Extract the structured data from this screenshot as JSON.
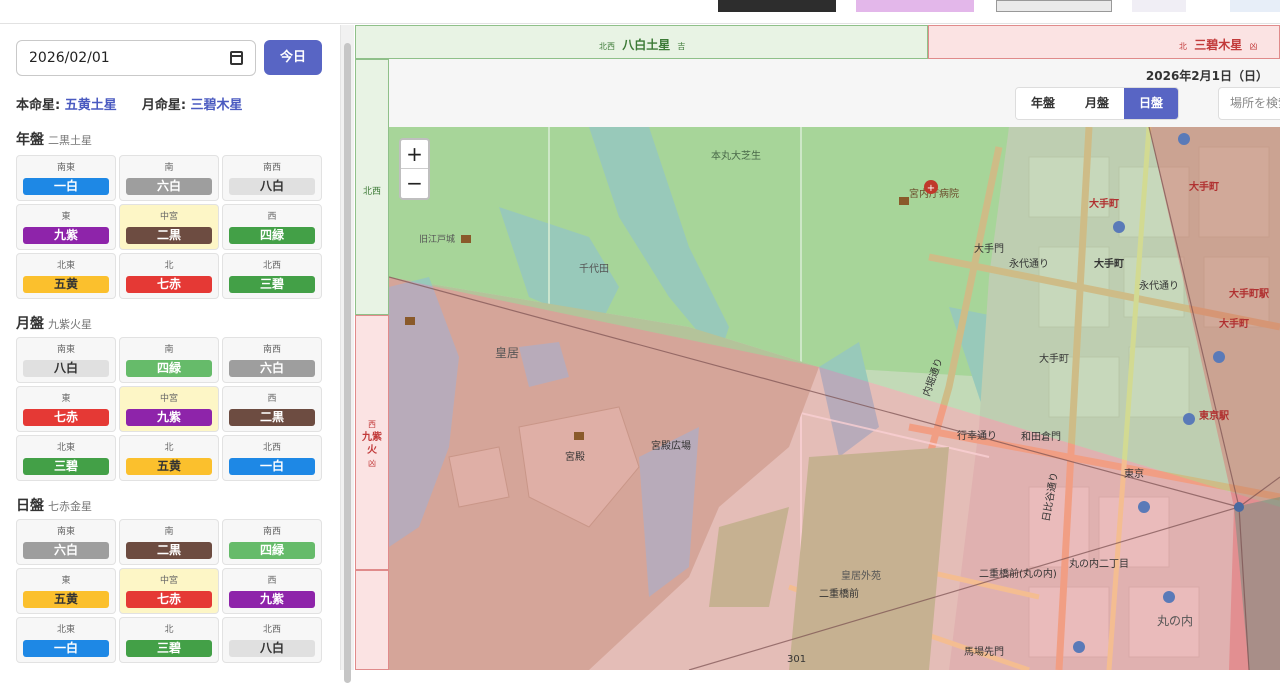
{
  "sidebar": {
    "date_value": "2026/02/01",
    "today_label": "今日",
    "honmei_label": "本命星:",
    "honmei_star": "五黄土星",
    "getsumei_label": "月命星:",
    "getsumei_star": "三碧木星",
    "sections": [
      {
        "title": "年盤",
        "subtitle": "二黒土星",
        "cells": [
          {
            "dir": "南東",
            "star": "一白",
            "color": "#1e88e5",
            "text": "#ffffff"
          },
          {
            "dir": "南",
            "star": "六白",
            "color": "#9e9e9e",
            "text": "#ffffff"
          },
          {
            "dir": "南西",
            "star": "八白",
            "color": "#e0e0e0",
            "text": "#333333"
          },
          {
            "dir": "東",
            "star": "九紫",
            "color": "#8e24aa",
            "text": "#ffffff"
          },
          {
            "dir": "中宮",
            "star": "二黒",
            "color": "#6d4c41",
            "text": "#ffffff"
          },
          {
            "dir": "西",
            "star": "四緑",
            "color": "#43a047",
            "text": "#ffffff"
          },
          {
            "dir": "北東",
            "star": "五黄",
            "color": "#fbc02d",
            "text": "#333333"
          },
          {
            "dir": "北",
            "star": "七赤",
            "color": "#e53935",
            "text": "#ffffff"
          },
          {
            "dir": "北西",
            "star": "三碧",
            "color": "#43a047",
            "text": "#ffffff"
          }
        ]
      },
      {
        "title": "月盤",
        "subtitle": "九紫火星",
        "cells": [
          {
            "dir": "南東",
            "star": "八白",
            "color": "#e0e0e0",
            "text": "#333333"
          },
          {
            "dir": "南",
            "star": "四緑",
            "color": "#66bb6a",
            "text": "#ffffff"
          },
          {
            "dir": "南西",
            "star": "六白",
            "color": "#9e9e9e",
            "text": "#ffffff"
          },
          {
            "dir": "東",
            "star": "七赤",
            "color": "#e53935",
            "text": "#ffffff"
          },
          {
            "dir": "中宮",
            "star": "九紫",
            "color": "#8e24aa",
            "text": "#ffffff"
          },
          {
            "dir": "西",
            "star": "二黒",
            "color": "#6d4c41",
            "text": "#ffffff"
          },
          {
            "dir": "北東",
            "star": "三碧",
            "color": "#43a047",
            "text": "#ffffff"
          },
          {
            "dir": "北",
            "star": "五黄",
            "color": "#fbc02d",
            "text": "#333333"
          },
          {
            "dir": "北西",
            "star": "一白",
            "color": "#1e88e5",
            "text": "#ffffff"
          }
        ]
      },
      {
        "title": "日盤",
        "subtitle": "七赤金星",
        "cells": [
          {
            "dir": "南東",
            "star": "六白",
            "color": "#9e9e9e",
            "text": "#ffffff"
          },
          {
            "dir": "南",
            "star": "二黒",
            "color": "#6d4c41",
            "text": "#ffffff"
          },
          {
            "dir": "南西",
            "star": "四緑",
            "color": "#66bb6a",
            "text": "#ffffff"
          },
          {
            "dir": "東",
            "star": "五黄",
            "color": "#fbc02d",
            "text": "#333333"
          },
          {
            "dir": "中宮",
            "star": "七赤",
            "color": "#e53935",
            "text": "#ffffff"
          },
          {
            "dir": "西",
            "star": "九紫",
            "color": "#8e24aa",
            "text": "#ffffff"
          },
          {
            "dir": "北東",
            "star": "一白",
            "color": "#1e88e5",
            "text": "#ffffff"
          },
          {
            "dir": "北",
            "star": "三碧",
            "color": "#43a047",
            "text": "#ffffff"
          },
          {
            "dir": "北西",
            "star": "八白",
            "color": "#e0e0e0",
            "text": "#333333"
          }
        ]
      }
    ]
  },
  "map": {
    "band_top_left": {
      "dir": "北西",
      "star": "八白土星",
      "mark": "吉"
    },
    "band_top_right": {
      "dir": "北",
      "star": "三碧木星",
      "mark": "凶"
    },
    "side_top_label": "北西",
    "side_mid_dir": "西",
    "side_mid_star1": "九紫",
    "side_mid_star2": "火",
    "side_mid_mark": "凶",
    "date_display": "2026年2月1日（日）",
    "view_buttons": [
      "年盤",
      "月盤",
      "日盤"
    ],
    "active_view": "日盤",
    "search_placeholder": "場所を検索...",
    "zoom_in": "+",
    "zoom_out": "−",
    "labels": [
      {
        "text": "本丸大芝生",
        "color": "#4a6a4a"
      },
      {
        "text": "宮内庁病院",
        "color": "#6a4a2a"
      },
      {
        "text": "大手町",
        "color": "#b03030"
      },
      {
        "text": "大手町",
        "color": "#b03030"
      },
      {
        "text": "大手町",
        "color": "#b03030"
      },
      {
        "text": "大手門",
        "color": "#333333"
      },
      {
        "text": "永代通り",
        "color": "#333333"
      },
      {
        "text": "永代通り",
        "color": "#333333"
      },
      {
        "text": "大手町駅",
        "color": "#b03030"
      },
      {
        "text": "大手町",
        "color": "#333333"
      },
      {
        "text": "大手町",
        "color": "#333333"
      },
      {
        "text": "皇居",
        "color": "#555555"
      },
      {
        "text": "宮殿",
        "color": "#333333"
      },
      {
        "text": "宮殿広場",
        "color": "#333333"
      },
      {
        "text": "和田倉門",
        "color": "#333333"
      },
      {
        "text": "行幸通り",
        "color": "#333333"
      },
      {
        "text": "東京駅",
        "color": "#b03030"
      },
      {
        "text": "東京",
        "color": "#333333"
      },
      {
        "text": "皇居外苑",
        "color": "#555555"
      },
      {
        "text": "二重橋前",
        "color": "#333333"
      },
      {
        "text": "二重橋前(丸の内)",
        "color": "#333333"
      },
      {
        "text": "丸の内二丁目",
        "color": "#333333"
      },
      {
        "text": "丸の内",
        "color": "#555555"
      },
      {
        "text": "内堀通り",
        "color": "#333333"
      },
      {
        "text": "日比谷通り",
        "color": "#333333"
      },
      {
        "text": "馬場先門",
        "color": "#333333"
      },
      {
        "text": "301",
        "color": "#333333"
      },
      {
        "text": "千代田",
        "color": "#555555"
      },
      {
        "text": "旧江戸城",
        "color": "#555555"
      }
    ]
  }
}
